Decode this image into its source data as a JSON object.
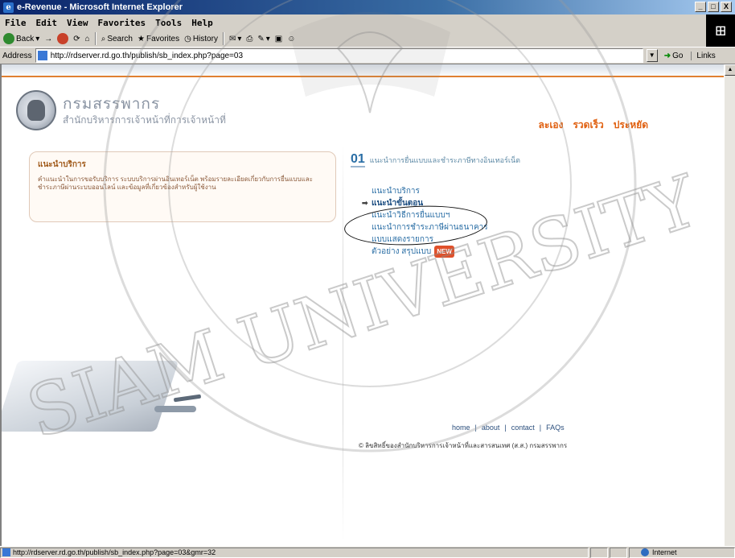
{
  "window": {
    "title": "e-Revenue - Microsoft Internet Explorer",
    "buttons": [
      "_",
      "□",
      "X"
    ]
  },
  "menu": [
    "File",
    "Edit",
    "View",
    "Favorites",
    "Tools",
    "Help"
  ],
  "toolbar": {
    "back": "Back",
    "search": "Search",
    "favorites": "Favorites",
    "history": "History"
  },
  "address": {
    "label": "Address",
    "url": "http://rdserver.rd.go.th/publish/sb_index.php?page=03",
    "go": "Go",
    "links": "Links"
  },
  "page": {
    "logo_title": "กรมสรรพากร",
    "logo_subtitle": "สำนักบริหารการเจ้าหน้าที่การเจ้าหน้าที่",
    "topnav": [
      "ละเอง",
      "รวดเร็ว",
      "ประหยัด"
    ],
    "left_panel_heading": "แนะนำบริการ",
    "left_panel_text": "คำแนะนำในการขอรับบริการ ระบบบริการผ่านอินเทอร์เน็ต พร้อมรายละเอียดเกี่ยวกับการยื่นแบบและชำระภาษีผ่านระบบออนไลน์ และข้อมูลที่เกี่ยวข้องสำหรับผู้ใช้งาน",
    "section_number": "01",
    "section_title": "แนะนำการยื่นแบบและชำระภาษีทางอินเทอร์เน็ต",
    "menu_items": [
      "แนะนำบริการ",
      "แนะนำขั้นตอน",
      "แนะนำวิธีการยื่นแบบฯ",
      "แนะนำการชำระภาษีผ่านธนาคาร",
      "แบบแสดงรายการ",
      "ตัวอย่าง สรุปแบบ"
    ],
    "new_badge": "NEW",
    "footer_links": [
      "home",
      "about",
      "contact",
      "FAQs"
    ],
    "footer_sep": "|",
    "copyright": "© ลิขสิทธิ์ของสำนักบริหารการเจ้าหน้าที่และสารสนเทศ (ส.ส.) กรมสรรพากร"
  },
  "status": {
    "url": "http://rdserver.rd.go.th/publish/sb_index.php?page=03&gmr=32",
    "zone": "Internet"
  },
  "watermark": {
    "text": "SIAM UNIVERSITY",
    "color": "#8c8c8c"
  },
  "colors": {
    "accent_orange": "#e06010",
    "link_blue": "#2a6ea5",
    "title_bar": "#0a246a"
  }
}
